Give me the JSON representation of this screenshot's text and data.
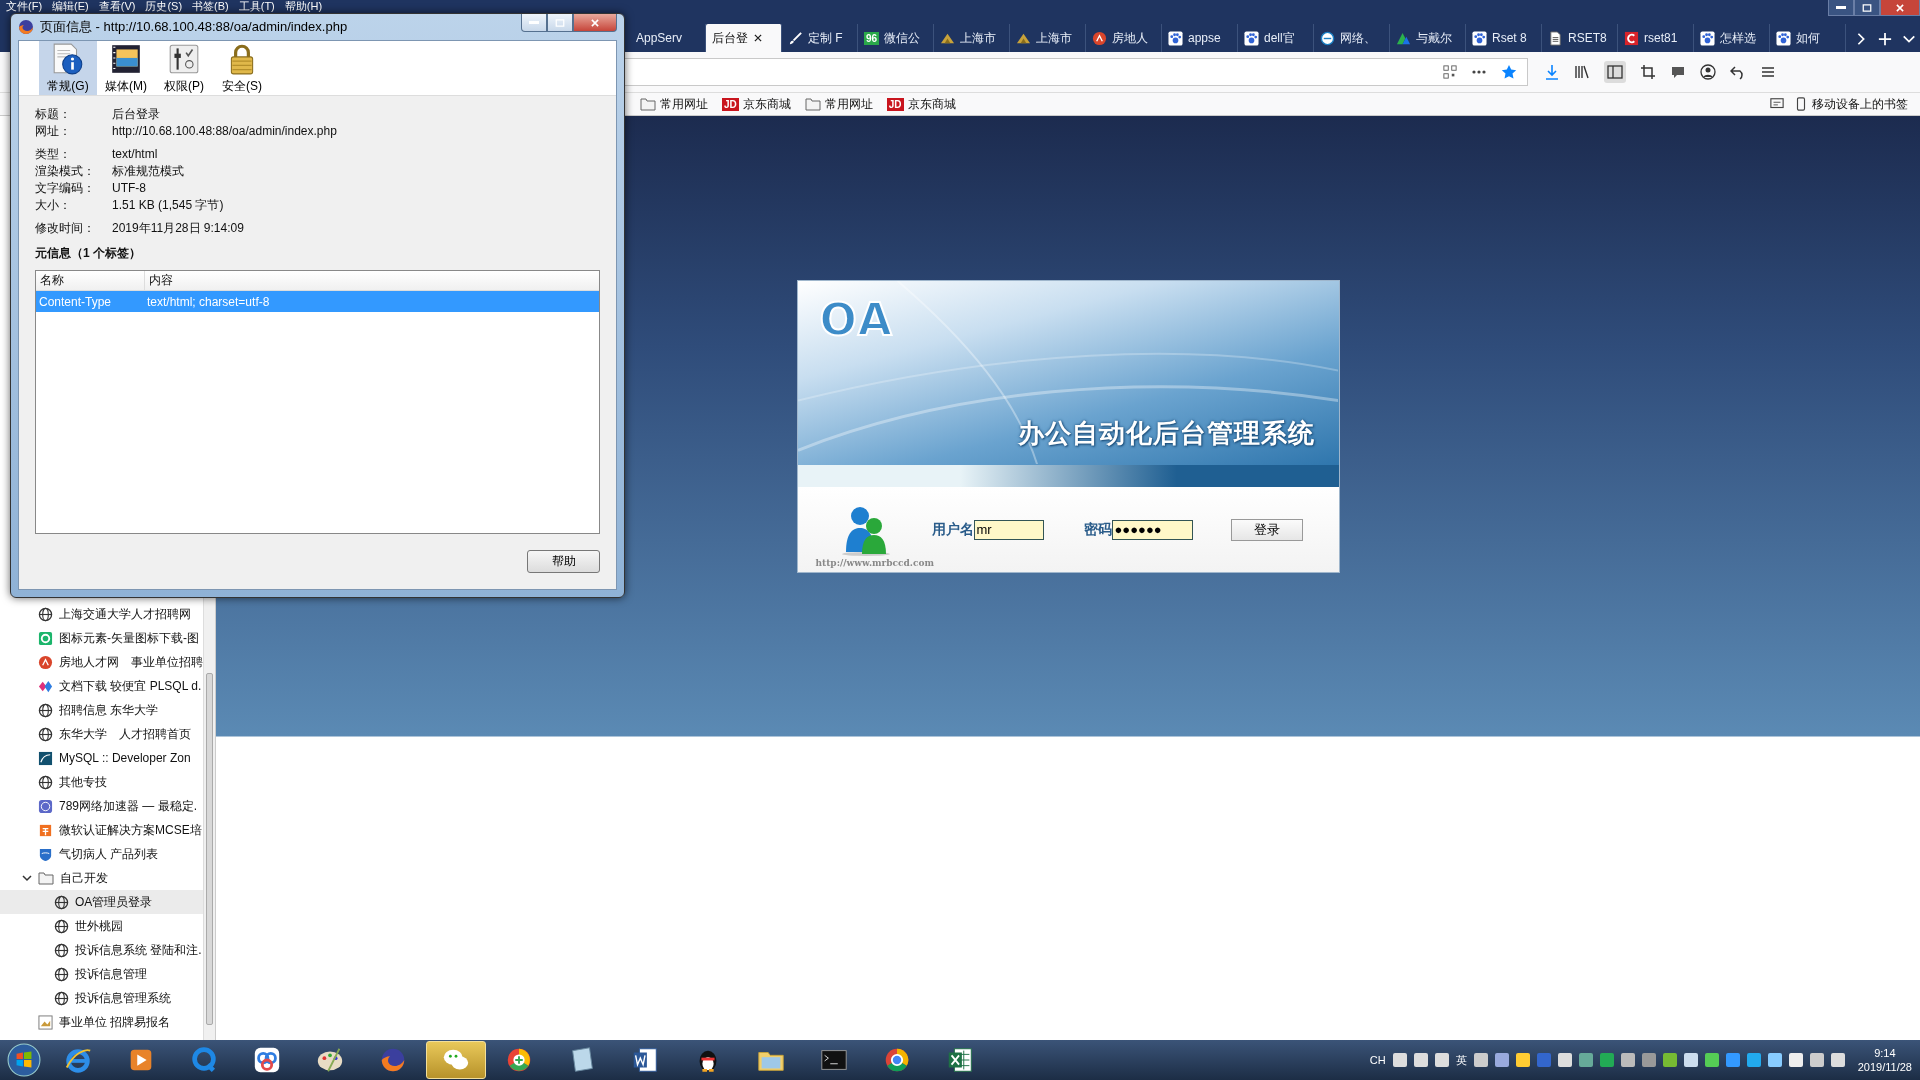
{
  "browser": {
    "menu_bar": [
      "文件(F)",
      "编辑(E)",
      "查看(V)",
      "历史(S)",
      "书签(B)",
      "工具(T)",
      "帮助(H)"
    ],
    "tabs": [
      {
        "label": "AppServ",
        "kind": "none",
        "selected": false
      },
      {
        "label": "后台登",
        "kind": "none",
        "selected": true
      },
      {
        "label": "定制 F",
        "kind": "brush",
        "selected": false
      },
      {
        "label": "微信公",
        "kind": "text",
        "badge": "96",
        "selected": false
      },
      {
        "label": "上海市",
        "kind": "mound",
        "selected": false
      },
      {
        "label": "上海市",
        "kind": "mound",
        "selected": false
      },
      {
        "label": "房地人",
        "kind": "redcircle",
        "selected": false
      },
      {
        "label": "appse",
        "kind": "paw",
        "selected": false
      },
      {
        "label": "dell官",
        "kind": "paw",
        "selected": false
      },
      {
        "label": "网络、",
        "kind": "ring",
        "selected": false
      },
      {
        "label": "与戴尔",
        "kind": "chevron",
        "selected": false
      },
      {
        "label": "Rset 8",
        "kind": "paw",
        "selected": false
      },
      {
        "label": "RSET8",
        "kind": "doc",
        "selected": false
      },
      {
        "label": "rset81",
        "kind": "c",
        "selected": false
      },
      {
        "label": "怎样选",
        "kind": "paw",
        "selected": false
      },
      {
        "label": "如何",
        "kind": "paw",
        "selected": false
      }
    ],
    "bookmarks": [
      {
        "label": "常用网址",
        "kind": "folder"
      },
      {
        "label": "京东商城",
        "kind": "logo",
        "badge": "JD"
      },
      {
        "label": "常用网址",
        "kind": "folder"
      },
      {
        "label": "京东商城",
        "kind": "logo",
        "badge": "JD"
      }
    ],
    "mobile_bookmarks": "移动设备上的书签"
  },
  "sidebar": {
    "items": [
      {
        "label": "上海交通大学人才招聘网",
        "kind": "globe",
        "selected": false
      },
      {
        "label": "图标元素-矢量图标下载-图",
        "kind": "greenring",
        "selected": false
      },
      {
        "label": "房地人才网　事业单位招聘",
        "kind": "redcircle",
        "selected": false
      },
      {
        "label": "文档下载 较便宜 PLSQL d.",
        "kind": "diamond",
        "selected": false
      },
      {
        "label": "招聘信息 东华大学",
        "kind": "globe",
        "selected": false
      },
      {
        "label": "东华大学　人才招聘首页",
        "kind": "globe",
        "selected": false
      },
      {
        "label": "MySQL :: Developer Zon",
        "kind": "dolphin",
        "selected": false
      },
      {
        "label": "其他专技",
        "kind": "globe",
        "selected": false
      },
      {
        "label": "789网络加速器 — 最稳定.",
        "kind": "bluecircle",
        "selected": false
      },
      {
        "label": "微软认证解决方案MCSE培",
        "kind": "orange",
        "selected": false
      },
      {
        "label": "气切病人 产品列表",
        "kind": "shield",
        "selected": false
      },
      {
        "label": "自己开发",
        "kind": "folder",
        "selected": false,
        "expanded": true,
        "children": [
          {
            "label": "OA管理员登录",
            "kind": "globe",
            "selected": true
          },
          {
            "label": "世外桃园",
            "kind": "globe",
            "selected": false
          },
          {
            "label": "投诉信息系统 登陆和注.",
            "kind": "globe",
            "selected": false
          },
          {
            "label": "投诉信息管理",
            "kind": "globe",
            "selected": false
          },
          {
            "label": "投诉信息管理系统",
            "kind": "globe",
            "selected": false
          }
        ]
      },
      {
        "label": "事业单位 招牌易报名",
        "kind": "picture",
        "selected": false
      }
    ]
  },
  "login": {
    "logo": "OA",
    "system_title": "办公自动化后台管理系统",
    "username_label": "用户名",
    "username": "mr",
    "password_label": "密码",
    "password": "●●●●●●",
    "login_button": "登录",
    "site_url": "http://www.mrbccd.com"
  },
  "dialog": {
    "title": "页面信息 - http://10.68.100.48:88/oa/admin/index.php",
    "tabs": [
      {
        "label": "常规(G)",
        "kind": "info",
        "selected": true
      },
      {
        "label": "媒体(M)",
        "kind": "media",
        "selected": false
      },
      {
        "label": "权限(P)",
        "kind": "perm",
        "selected": false
      },
      {
        "label": "安全(S)",
        "kind": "lock",
        "selected": false
      }
    ],
    "field_groups": [
      [
        {
          "label": "标题：",
          "value": "后台登录"
        },
        {
          "label": "网址：",
          "value": "http://10.68.100.48:88/oa/admin/index.php"
        }
      ],
      [
        {
          "label": "类型：",
          "value": "text/html"
        },
        {
          "label": "渲染模式：",
          "value": "标准规范模式"
        },
        {
          "label": "文字编码：",
          "value": "UTF-8"
        },
        {
          "label": "大小：",
          "value": "1.51 KB (1,545 字节)"
        }
      ],
      [
        {
          "label": "修改时间：",
          "value": "2019年11月28日 9:14:09"
        }
      ]
    ],
    "meta_heading": "元信息（1 个标签）",
    "table": {
      "columns": [
        "名称",
        "内容"
      ],
      "rows": [
        {
          "cells": [
            "Content-Type",
            "text/html; charset=utf-8"
          ],
          "selected": true
        }
      ]
    },
    "help_button": "帮助"
  },
  "taskbar": {
    "apps": [
      {
        "kind": "ie",
        "active": false
      },
      {
        "kind": "play",
        "active": false
      },
      {
        "kind": "q",
        "active": false
      },
      {
        "kind": "cloud",
        "active": false
      },
      {
        "kind": "palette",
        "active": false
      },
      {
        "kind": "fox",
        "active": false
      },
      {
        "kind": "chat",
        "active": true
      },
      {
        "kind": "plus",
        "active": false
      },
      {
        "kind": "pad",
        "active": false
      },
      {
        "kind": "word",
        "active": false
      },
      {
        "kind": "penguin",
        "active": false
      },
      {
        "kind": "folder",
        "active": false
      },
      {
        "kind": "terminal",
        "active": false
      },
      {
        "kind": "ring",
        "active": false
      },
      {
        "kind": "sheet",
        "active": false
      }
    ],
    "language": "CH",
    "ime": "英",
    "time": "9:14",
    "date": "2019/11/28"
  }
}
